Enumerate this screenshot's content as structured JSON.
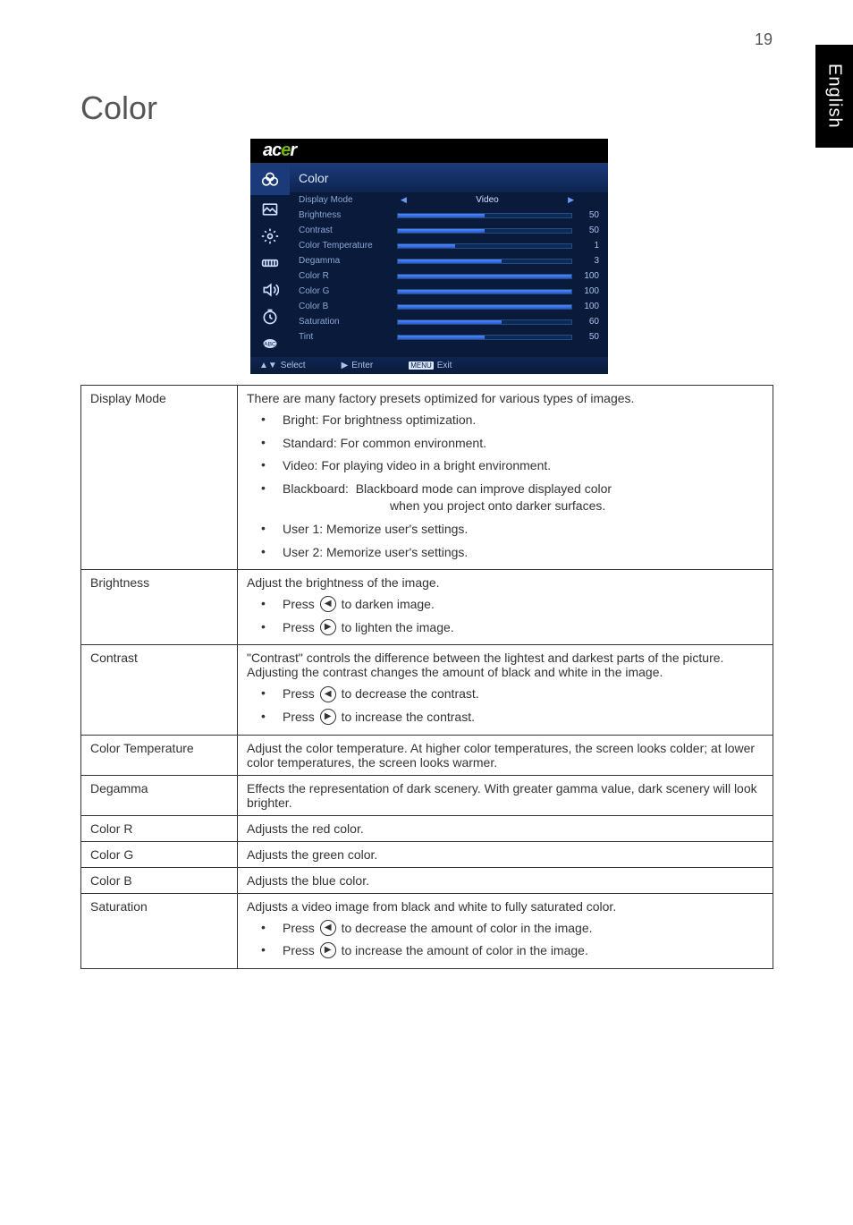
{
  "page": {
    "number": "19",
    "side_tab": "English",
    "title": "Color"
  },
  "osd": {
    "logo": "acer",
    "heading": "Color",
    "rows": [
      {
        "label": "Display Mode",
        "type": "mode",
        "value": "Video"
      },
      {
        "label": "Brightness",
        "type": "bar",
        "value": "50",
        "pct": 50
      },
      {
        "label": "Contrast",
        "type": "bar",
        "value": "50",
        "pct": 50
      },
      {
        "label": "Color Temperature",
        "type": "bar",
        "value": "1",
        "pct": 33
      },
      {
        "label": "Degamma",
        "type": "bar",
        "value": "3",
        "pct": 60
      },
      {
        "label": "Color R",
        "type": "bar",
        "value": "100",
        "pct": 100
      },
      {
        "label": "Color G",
        "type": "bar",
        "value": "100",
        "pct": 100
      },
      {
        "label": "Color B",
        "type": "bar",
        "value": "100",
        "pct": 100
      },
      {
        "label": "Saturation",
        "type": "bar",
        "value": "60",
        "pct": 60
      },
      {
        "label": "Tint",
        "type": "bar",
        "value": "50",
        "pct": 50
      }
    ],
    "footer": {
      "select": "Select",
      "enter": "Enter",
      "menu": "MENU",
      "exit": "Exit"
    }
  },
  "rows": {
    "display_mode": {
      "key": "Display Mode",
      "intro": "There are many factory presets optimized for various types of images.",
      "bullets": [
        "Bright: For brightness optimization.",
        "Standard: For common environment.",
        "Video: For playing video in a bright environment.",
        "Blackboard:  Blackboard mode can improve displayed color when you project onto darker surfaces.",
        "User 1: Memorize user's settings.",
        "User 2: Memorize user's settings."
      ]
    },
    "brightness": {
      "key": "Brightness",
      "intro": "Adjust the brightness of the image.",
      "press": "Press",
      "b1_tail": "to darken image.",
      "b2_tail": "to lighten the image."
    },
    "contrast": {
      "key": "Contrast",
      "intro": "\"Contrast\" controls the difference between the lightest and darkest parts of the picture. Adjusting the contrast changes the amount of black and white in the image.",
      "press": "Press",
      "b1_tail": "to decrease the contrast.",
      "b2_tail": "to increase the contrast."
    },
    "color_temp": {
      "key": "Color Temperature",
      "desc": "Adjust the color temperature. At higher color temperatures, the screen looks colder; at lower color temperatures, the screen looks warmer."
    },
    "degamma": {
      "key": "Degamma",
      "desc": "Effects the representation of dark scenery. With greater gamma value, dark scenery will look brighter."
    },
    "color_r": {
      "key": "Color R",
      "desc": "Adjusts the red color."
    },
    "color_g": {
      "key": "Color G",
      "desc": "Adjusts the green color."
    },
    "color_b": {
      "key": "Color B",
      "desc": "Adjusts the blue color."
    },
    "saturation": {
      "key": "Saturation",
      "intro": "Adjusts a video image from black and white to fully saturated color.",
      "press": "Press",
      "b1_tail": "to decrease the amount of color in the image.",
      "b2_tail": "to increase the amount of color in the image."
    }
  }
}
